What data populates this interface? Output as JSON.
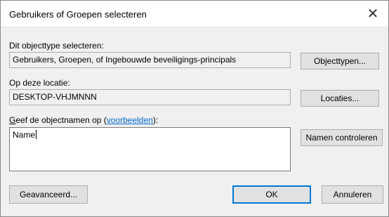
{
  "window": {
    "title": "Gebruikers of Groepen selecteren",
    "close_glyph": "✕"
  },
  "object_type": {
    "label": "Dit objecttype selecteren:",
    "value": "Gebruikers, Groepen, of Ingebouwde beveiligings-principals",
    "button_label": "Objecttypen..."
  },
  "location": {
    "label": "Op deze locatie:",
    "value": "DESKTOP-VHJMNNN",
    "button_label": "Locaties..."
  },
  "names": {
    "label_accel": "G",
    "label_rest": "eef de objectnamen op (",
    "link_text": "voorbeelden",
    "label_end": "):",
    "value": "Name",
    "check_button_label": "Namen controleren"
  },
  "footer": {
    "advanced_label": "Geavanceerd...",
    "ok_label": "OK",
    "cancel_label": "Annuleren"
  }
}
